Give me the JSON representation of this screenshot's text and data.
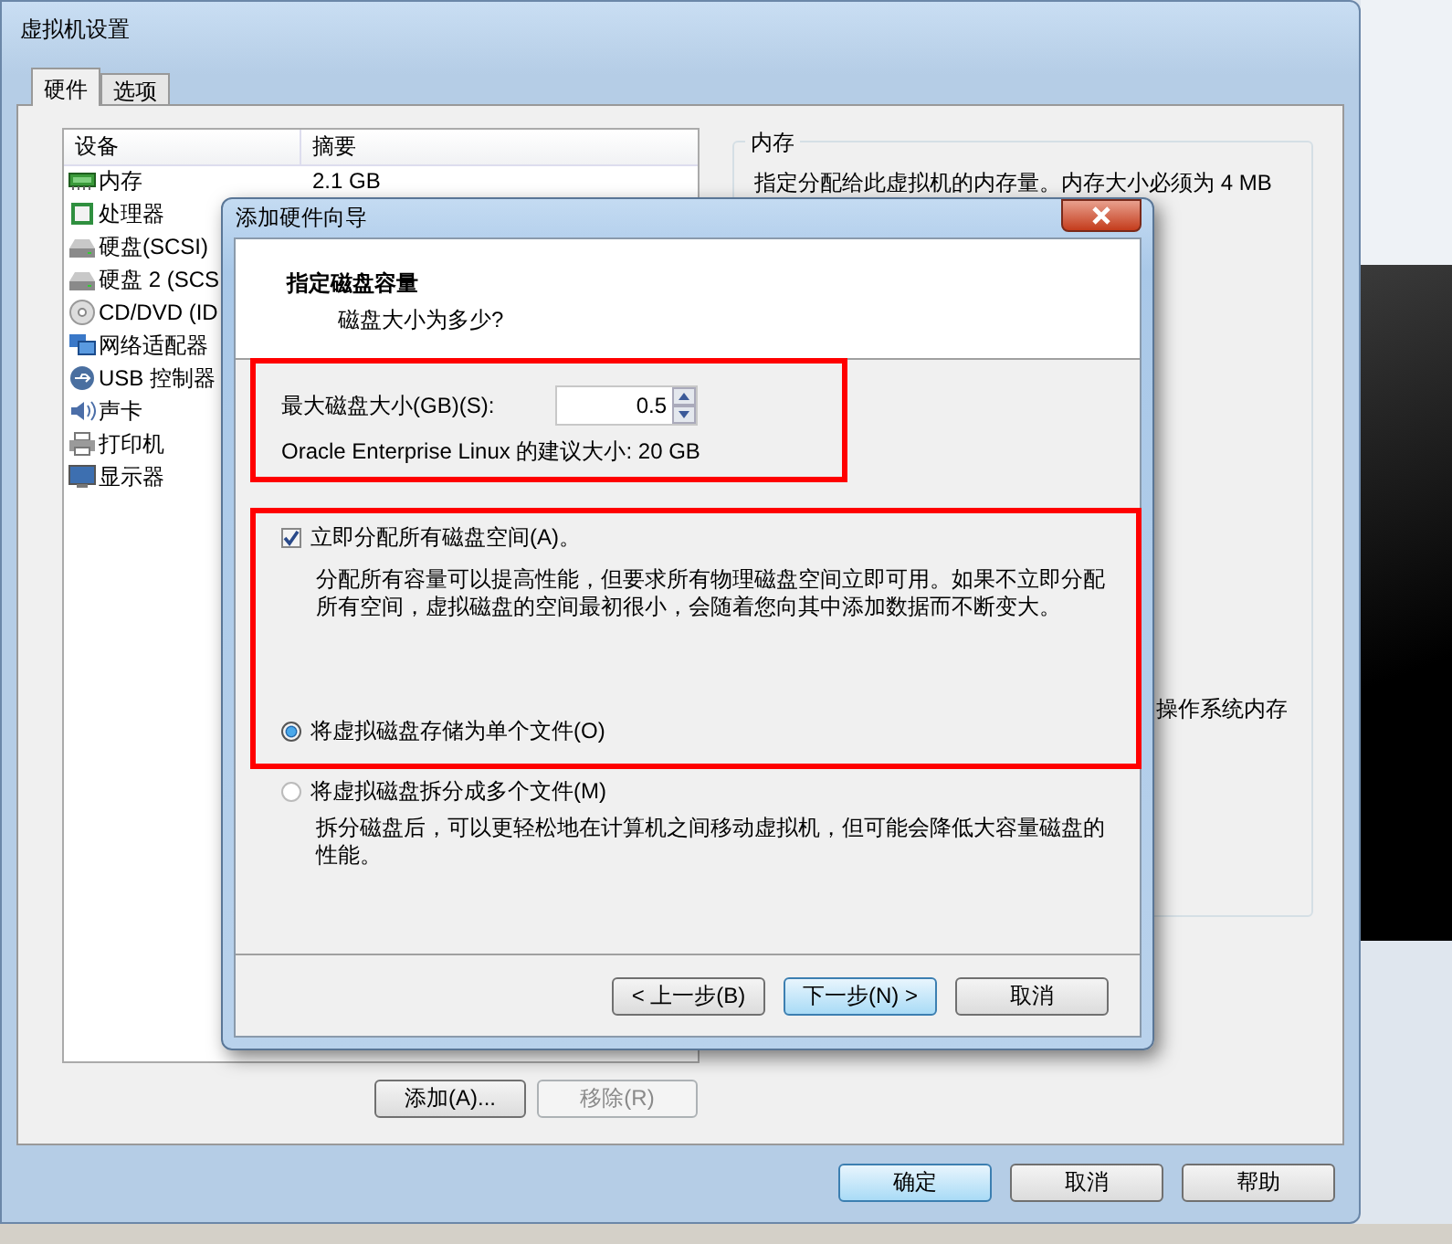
{
  "window": {
    "title": "虚拟机设置"
  },
  "tabs": [
    {
      "label": "硬件",
      "selected": true
    },
    {
      "label": "选项",
      "selected": false
    }
  ],
  "device_list": {
    "columns": [
      "设备",
      "摘要"
    ],
    "rows": [
      {
        "device": "内存",
        "summary": "2.1 GB"
      },
      {
        "device": "处理器"
      },
      {
        "device": "硬盘(SCSI)"
      },
      {
        "device": "硬盘 2 (SCS"
      },
      {
        "device": "CD/DVD (ID"
      },
      {
        "device": "网络适配器"
      },
      {
        "device": "USB 控制器"
      },
      {
        "device": "声卡"
      },
      {
        "device": "打印机"
      },
      {
        "device": "显示器"
      }
    ]
  },
  "list_buttons": [
    {
      "label": "添加(A)...",
      "disabled": false
    },
    {
      "label": "移除(R)",
      "disabled": true
    }
  ],
  "memory_group": {
    "title": "内存",
    "description": "指定分配给此虚拟机的内存量。内存大小必须为 4 MB",
    "partial_text": "操作系统内存"
  },
  "footer_buttons": [
    {
      "label": "确定",
      "default": true
    },
    {
      "label": "取消",
      "default": false
    },
    {
      "label": "帮助",
      "default": false
    }
  ],
  "dialog": {
    "title": "添加硬件向导",
    "heading": "指定磁盘容量",
    "subheading": "磁盘大小为多少?",
    "size_label": "最大磁盘大小(GB)(S):",
    "size_value": "0.5",
    "recommendation": "Oracle Enterprise Linux 的建议大小: 20 GB",
    "allocate": {
      "label": "立即分配所有磁盘空间(A)。",
      "checked": true,
      "description": "分配所有容量可以提高性能，但要求所有物理磁盘空间立即可用。如果不立即分配所有空间，虚拟磁盘的空间最初很小，会随着您向其中添加数据而不断变大。"
    },
    "storage_options": [
      {
        "label": "将虚拟磁盘存储为单个文件(O)",
        "selected": true
      },
      {
        "label": "将虚拟磁盘拆分成多个文件(M)",
        "selected": false,
        "description": "拆分磁盘后，可以更轻松地在计算机之间移动虚拟机，但可能会降低大容量磁盘的性能。"
      }
    ],
    "buttons": [
      {
        "label": "< 上一步(B)",
        "default": false
      },
      {
        "label": "下一步(N) >",
        "default": true
      },
      {
        "label": "取消",
        "default": false
      }
    ]
  },
  "annotation_boxes": [
    {
      "kind": "rectangle"
    },
    {
      "kind": "rectangle"
    }
  ]
}
